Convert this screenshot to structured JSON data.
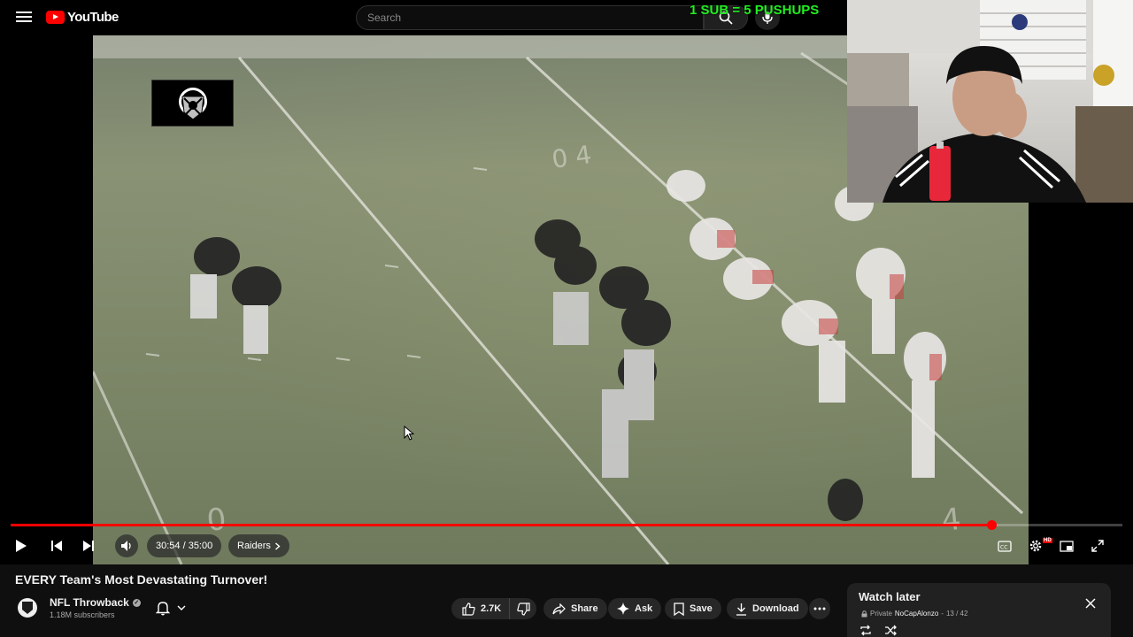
{
  "masthead": {
    "logo_text": "YouTube",
    "search_placeholder": "Search"
  },
  "overlay": {
    "promo_text": "1 SUB = 5 PUSHUPS"
  },
  "player": {
    "current_time": "30:54",
    "duration": "35:00",
    "time_display": "30:54 / 35:00",
    "chapter": "Raiders",
    "progress_fraction": 0.882
  },
  "video": {
    "title": "EVERY Team's Most Devastating Turnover!"
  },
  "channel": {
    "name": "NFL Throwback",
    "subscribers": "1.18M subscribers"
  },
  "actions": {
    "like_count": "2.7K",
    "share": "Share",
    "ask": "Ask",
    "save": "Save",
    "download": "Download"
  },
  "watch_later": {
    "title": "Watch later",
    "privacy": "Private",
    "owner": "NoCapAlonzo",
    "position": "13 / 42"
  },
  "colors": {
    "accent": "#ff0000",
    "promo": "#22ee22",
    "background": "#0f0f0f"
  }
}
